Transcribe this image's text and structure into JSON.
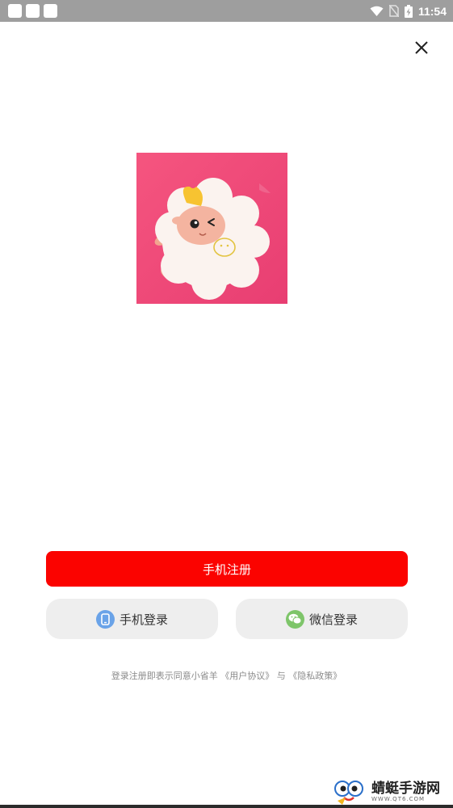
{
  "status_bar": {
    "time": "11:54",
    "icons": [
      "wifi-icon",
      "no-sim-icon",
      "battery-charging-icon"
    ]
  },
  "header": {
    "close_icon": "close-icon"
  },
  "logo": {
    "description_icon": "sheep-app-logo"
  },
  "actions": {
    "register_label": "手机注册",
    "phone_login_label": "手机登录",
    "wechat_login_label": "微信登录",
    "phone_icon": "phone-icon",
    "wechat_icon": "wechat-icon"
  },
  "agreement": {
    "prefix": "登录注册即表示同意小省羊",
    "user_agreement": "《用户协议》",
    "conjunction": "与",
    "privacy_policy": "《隐私政策》"
  },
  "watermark": {
    "title": "蜻蜓手游网",
    "url": "WWW.QT6.COM"
  },
  "colors": {
    "primary": "#fb0300",
    "status_bar": "#9e9e9e",
    "logo_bg": "#ee4478",
    "phone_icon": "#6aa3e8",
    "wechat_icon": "#7ec56a",
    "secondary_btn": "#eeeeee"
  }
}
